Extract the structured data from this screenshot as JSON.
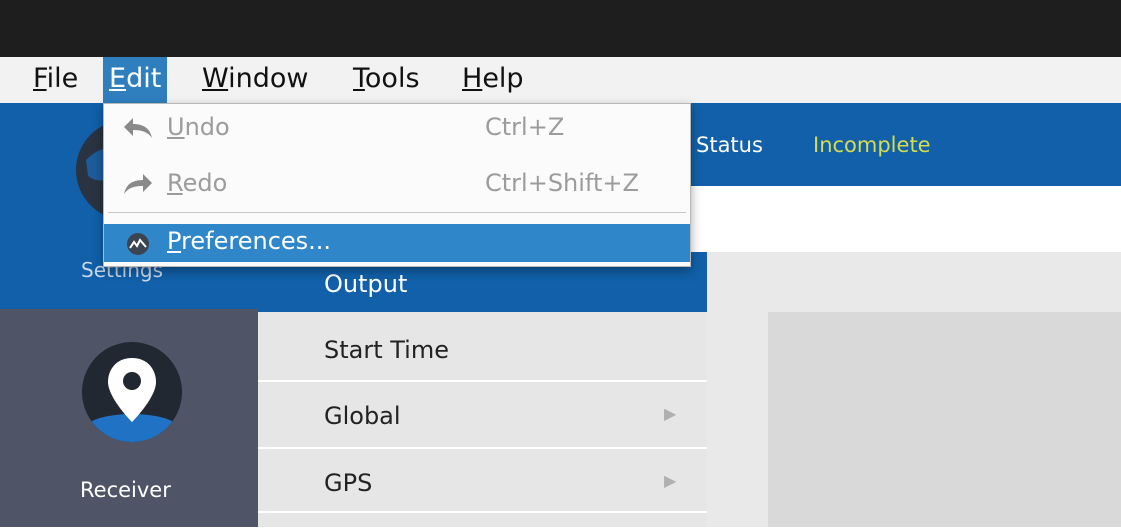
{
  "menubar": {
    "items": [
      {
        "mnemonic": "F",
        "rest": "ile"
      },
      {
        "mnemonic": "E",
        "rest": "dit"
      },
      {
        "mnemonic": "W",
        "rest": "indow"
      },
      {
        "mnemonic": "T",
        "rest": "ools"
      },
      {
        "mnemonic": "H",
        "rest": "elp"
      }
    ],
    "active_item": "Edit"
  },
  "edit_menu": {
    "items": [
      {
        "mnemonic": "U",
        "rest": "ndo",
        "shortcut": "Ctrl+Z",
        "icon": "undo-icon",
        "enabled": false
      },
      {
        "mnemonic": "R",
        "rest": "edo",
        "shortcut": "Ctrl+Shift+Z",
        "icon": "redo-icon",
        "enabled": false
      },
      {
        "mnemonic": "P",
        "rest": "references...",
        "shortcut": "",
        "icon": "preferences-icon",
        "enabled": true,
        "highlighted": true
      }
    ]
  },
  "header": {
    "status_label": "Status",
    "status_value": "Incomplete"
  },
  "sidebar": {
    "items": [
      {
        "label": "Settings",
        "icon": "globe-icon",
        "active": true
      },
      {
        "label": "Receiver",
        "icon": "location-pin-icon",
        "active": false
      }
    ]
  },
  "tree": {
    "items": [
      {
        "label": "Output",
        "selected": true,
        "has_children": false
      },
      {
        "label": "Start Time",
        "selected": false,
        "has_children": false
      },
      {
        "label": "Global",
        "selected": false,
        "has_children": true
      },
      {
        "label": "GPS",
        "selected": false,
        "has_children": true
      }
    ],
    "expand_glyph": "▶"
  },
  "colors": {
    "accent_blue": "#1160a9",
    "menu_highlight": "#2f87c9",
    "status_incomplete": "#d5dc4e",
    "sidebar_dark": "#4f5566"
  }
}
